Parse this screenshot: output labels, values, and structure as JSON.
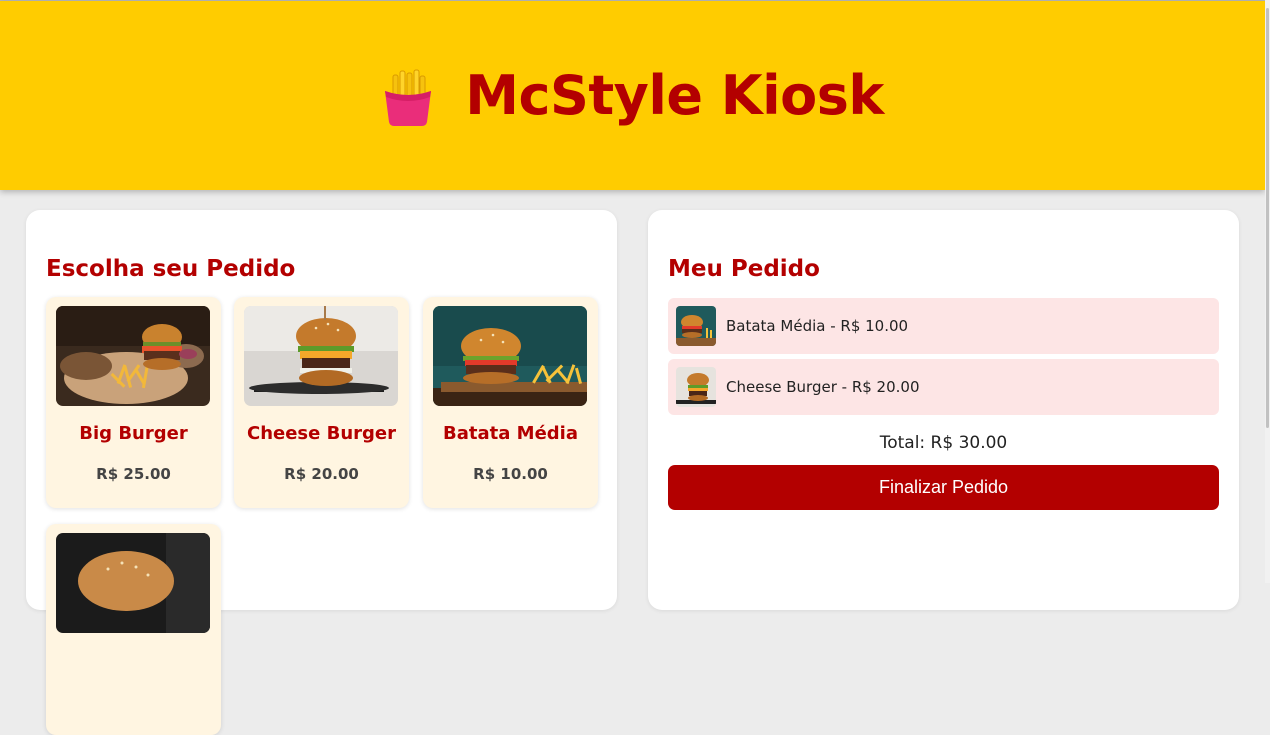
{
  "header": {
    "title": "McStyle Kiosk",
    "logo_icon": "fries-icon"
  },
  "menu": {
    "title": "Escolha seu Pedido",
    "products": [
      {
        "name": "Big Burger",
        "price": "R$ 25.00",
        "icon": "burger-fries-photo"
      },
      {
        "name": "Cheese Burger",
        "price": "R$ 20.00",
        "icon": "cheese-burger-photo"
      },
      {
        "name": "Batata Média",
        "price": "R$ 10.00",
        "icon": "burger-fries-board-photo"
      },
      {
        "name": "",
        "price": "",
        "icon": "burger-photo"
      }
    ]
  },
  "order": {
    "title": "Meu Pedido",
    "items": [
      {
        "text": "Batata Média - R$ 10.00"
      },
      {
        "text": "Cheese Burger - R$ 20.00"
      }
    ],
    "total": "Total: R$ 30.00",
    "checkout_label": "Finalizar Pedido"
  },
  "colors": {
    "header_bg": "#ffcc00",
    "brand_red": "#b30000",
    "card_bg": "#fff5e1",
    "order_item_bg": "#fde5e5"
  }
}
